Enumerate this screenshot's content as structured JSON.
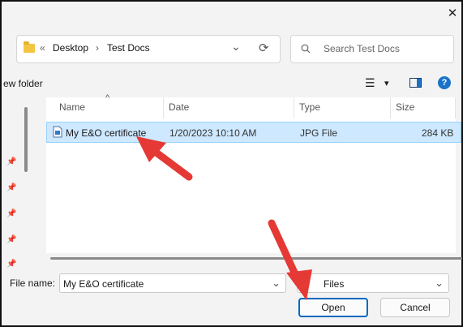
{
  "window": {
    "close_glyph": "✕"
  },
  "address_bar": {
    "prefix": "«",
    "crumbs": [
      "Desktop",
      "Test Docs"
    ],
    "separator": "›",
    "dropdown_glyph": "⌄",
    "refresh_glyph": "⟳"
  },
  "search": {
    "placeholder": "Search Test Docs",
    "icon": "search-icon"
  },
  "toolbar": {
    "new_folder_label": "ew folder",
    "view_glyph": "☰",
    "view_dropdown_glyph": "▾",
    "help_glyph": "?"
  },
  "file_list": {
    "sort_glyph": "^",
    "columns": {
      "name": "Name",
      "date": "Date",
      "type": "Type",
      "size": "Size"
    },
    "rows": [
      {
        "name": "My E&O certificate",
        "date": "1/20/2023 10:10 AM",
        "type": "JPG File",
        "size": "284 KB"
      }
    ]
  },
  "footer": {
    "file_name_label": "File name:",
    "file_name_value": "My E&O certificate",
    "file_type_value": "Files",
    "open_label": "Open",
    "cancel_label": "Cancel"
  },
  "colors": {
    "selection": "#cde8ff",
    "accent": "#0067c0",
    "arrow": "#e53935"
  }
}
